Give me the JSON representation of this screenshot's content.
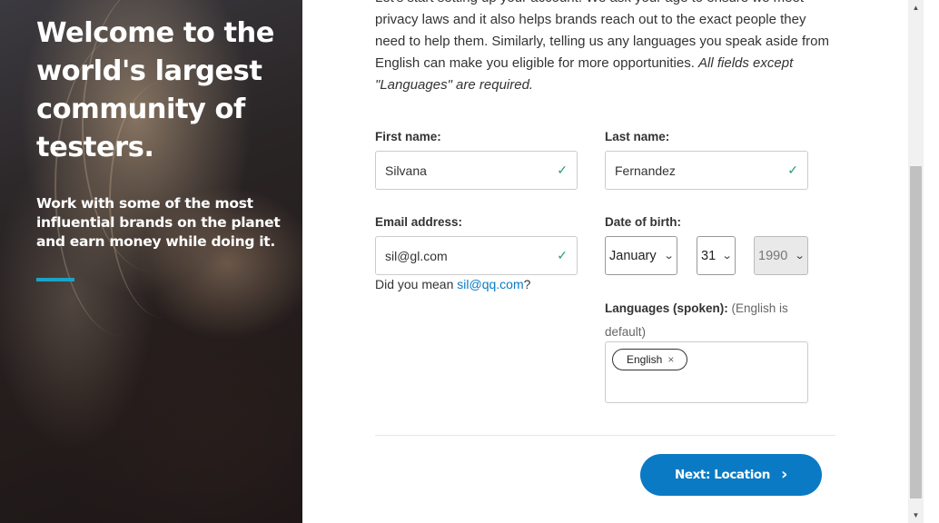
{
  "hero": {
    "title": "Welcome to the world's largest community of testers.",
    "subtitle": "Work with some of the most influential brands on the planet and earn money while doing it.",
    "accent_color": "#1ba3c6"
  },
  "intro": {
    "text": "Let's start setting up your account. We ask your age to ensure we meet privacy laws and it also helps brands reach out to the exact people they need to help them. Similarly, telling us any languages you speak aside from English can make you eligible for more opportunities. ",
    "note": "All fields except \"Languages\" are required."
  },
  "form": {
    "first_name": {
      "label": "First name:",
      "value": "Silvana",
      "valid_icon": "checkmark-icon"
    },
    "last_name": {
      "label": "Last name:",
      "value": "Fernandez",
      "valid_icon": "checkmark-icon"
    },
    "email": {
      "label": "Email address:",
      "value": "sil@gl.com",
      "valid_icon": "checkmark-icon"
    },
    "email_suggestion": {
      "prefix": "Did you mean ",
      "link": "sil@qq.com",
      "suffix": "?"
    },
    "dob": {
      "label": "Date of birth:",
      "month": "January",
      "day": "31",
      "year": "1990"
    },
    "languages": {
      "label": "Languages (spoken):",
      "hint": "(English is default)",
      "chips": [
        {
          "label": "English",
          "remove": "×"
        }
      ]
    }
  },
  "actions": {
    "next_label": "Next: Location",
    "next_icon": "chevron-right-icon",
    "primary_color": "#0a7ac4"
  },
  "colors": {
    "valid": "#27a06b",
    "link": "#0a7ac4"
  }
}
